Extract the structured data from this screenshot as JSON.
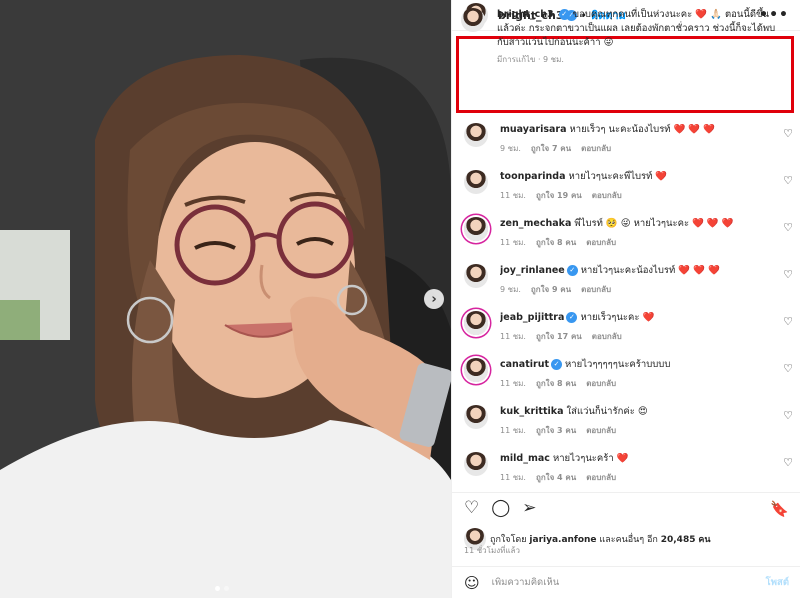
{
  "colors": {
    "accent": "#0095f6",
    "verified": "#3897f0",
    "highlight_border": "#e0000b",
    "heart": "#ed2c5a"
  },
  "carousel": {
    "next_icon": "chevron-right-icon",
    "slide_count": 2,
    "active_slide": 1
  },
  "header": {
    "username": "bright_ch3",
    "verified": true,
    "separator": "•",
    "follow_label": "ติดตาม",
    "more_icon": "more-horizontal-icon",
    "more_label": "•••"
  },
  "caption": {
    "username": "bright_ch3",
    "text": "ขอบคุณทุกคนที่เป็นห่วงนะคะ ❤️ 🙏🏻 ตอนนี้ดีขึ้นแล้วค่ะ กระจกตาขวาเป็นแผล เลยต้องพักตาชั่วคราว ช่วงนี้ก็จะได้พบกับสาวแว่นไปก่อนนะค้าา 😜",
    "meta": "มีการแก้ไข · 9 ชม."
  },
  "comments": [
    {
      "username": "muayarisara",
      "verified": false,
      "text": "หายเร็วๆ นะคะน้องไบรท์ ❤️ ❤️ ❤️",
      "time": "9 ชม.",
      "likes": "ถูกใจ 7 คน",
      "reply": "ตอบกลับ"
    },
    {
      "username": "toonparinda",
      "verified": false,
      "text": "หายไวๆนะคะพี่ไบรท์ ❤️",
      "time": "11 ชม.",
      "likes": "ถูกใจ 19 คน",
      "reply": "ตอบกลับ"
    },
    {
      "username": "zen_mechaka",
      "verified": false,
      "text": "พี่ไบรท์ 🥺 😜 หายไวๆนะคะ ❤️ ❤️ ❤️",
      "time": "11 ชม.",
      "likes": "ถูกใจ 8 คน",
      "reply": "ตอบกลับ"
    },
    {
      "username": "joy_rinlanee",
      "verified": true,
      "text": "หายไวๆนะคะน้องไบรท์ ❤️ ❤️ ❤️",
      "time": "9 ชม.",
      "likes": "ถูกใจ 9 คน",
      "reply": "ตอบกลับ"
    },
    {
      "username": "jeab_pijittra",
      "verified": true,
      "text": "หายเร็วๆนะคะ ❤️",
      "time": "11 ชม.",
      "likes": "ถูกใจ 17 คน",
      "reply": "ตอบกลับ"
    },
    {
      "username": "canatirut",
      "verified": true,
      "text": "หายไวๆๆๆๆๆนะคร้าบบบบ",
      "time": "11 ชม.",
      "likes": "ถูกใจ 8 คน",
      "reply": "ตอบกลับ"
    },
    {
      "username": "kuk_krittika",
      "verified": false,
      "text": "ใส่แว่นก็น่ารักค่ะ 😍",
      "time": "11 ชม.",
      "likes": "ถูกใจ 3 คน",
      "reply": "ตอบกลับ"
    },
    {
      "username": "mild_mac",
      "verified": false,
      "text": "หายไวๆนะคร้า ❤️",
      "time": "11 ชม.",
      "likes": "ถูกใจ 4 คน",
      "reply": "ตอบกลับ"
    }
  ],
  "actions": {
    "like_icon": "heart-outline-icon",
    "comment_icon": "comment-icon",
    "share_icon": "send-icon",
    "save_icon": "bookmark-icon",
    "like_glyph": "♡",
    "comment_glyph": "◯",
    "share_glyph": "➢",
    "save_glyph": "🔖"
  },
  "likes": {
    "prefix": "ถูกใจโดย",
    "user": "jariya.anfone",
    "middle": "และคนอื่นๆ อีก",
    "count": "20,485",
    "suffix": "คน"
  },
  "post_time": "11 ชั่วโมงที่แล้ว",
  "comment_input": {
    "emoji_glyph": "☺",
    "placeholder": "เพิ่มความคิดเห็น",
    "value": "",
    "post_label": "โพสต์"
  },
  "like_glyph": "♡"
}
